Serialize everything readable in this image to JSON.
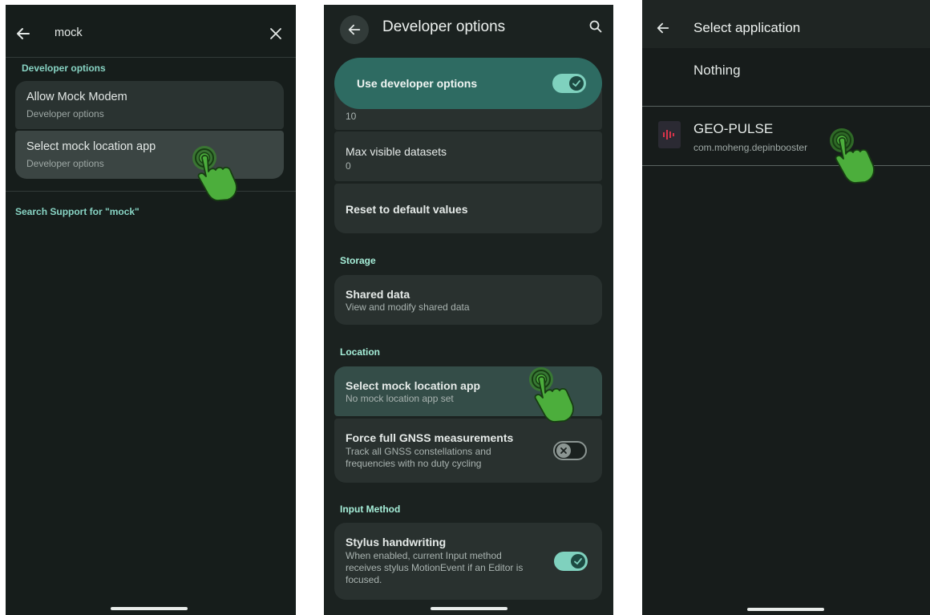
{
  "screen1": {
    "search_query": "mock",
    "section_header": "Developer options",
    "results": [
      {
        "title": "Allow Mock Modem",
        "subtitle": "Developer options"
      },
      {
        "title": "Select mock location app",
        "subtitle": "Developer options"
      }
    ],
    "search_support": "Search Support for \"mock\""
  },
  "screen2": {
    "title": "Developer options",
    "master_toggle": {
      "label": "Use developer options",
      "checked": true
    },
    "partial_value": "10",
    "items": [
      {
        "title": "Max visible datasets",
        "subtitle": "0"
      },
      {
        "title": "Reset to default values"
      }
    ],
    "sections": {
      "storage": "Storage",
      "location": "Location",
      "input_method": "Input Method"
    },
    "shared_data": {
      "title": "Shared data",
      "subtitle": "View and modify shared data"
    },
    "mock_location": {
      "title": "Select mock location app",
      "subtitle": "No mock location app set"
    },
    "gnss": {
      "title": "Force full GNSS measurements",
      "subtitle_lines": [
        "Track all GNSS constellations and",
        "frequencies with no duty cycling"
      ],
      "checked": false
    },
    "stylus": {
      "title": "Stylus handwriting",
      "subtitle_lines": [
        "When enabled, current Input method",
        "receives stylus MotionEvent if an Editor is",
        "focused."
      ],
      "checked": true
    }
  },
  "screen3": {
    "title": "Select application",
    "options": [
      {
        "label": "Nothing"
      },
      {
        "label": "GEO-PULSE",
        "package": "com.moheng.depinbooster"
      }
    ]
  },
  "colors": {
    "accent": "#88d4c4",
    "toggle_on": "#7fd1be",
    "highlight_teal": "#2e6b62",
    "hand_green": "#4cae3c"
  }
}
